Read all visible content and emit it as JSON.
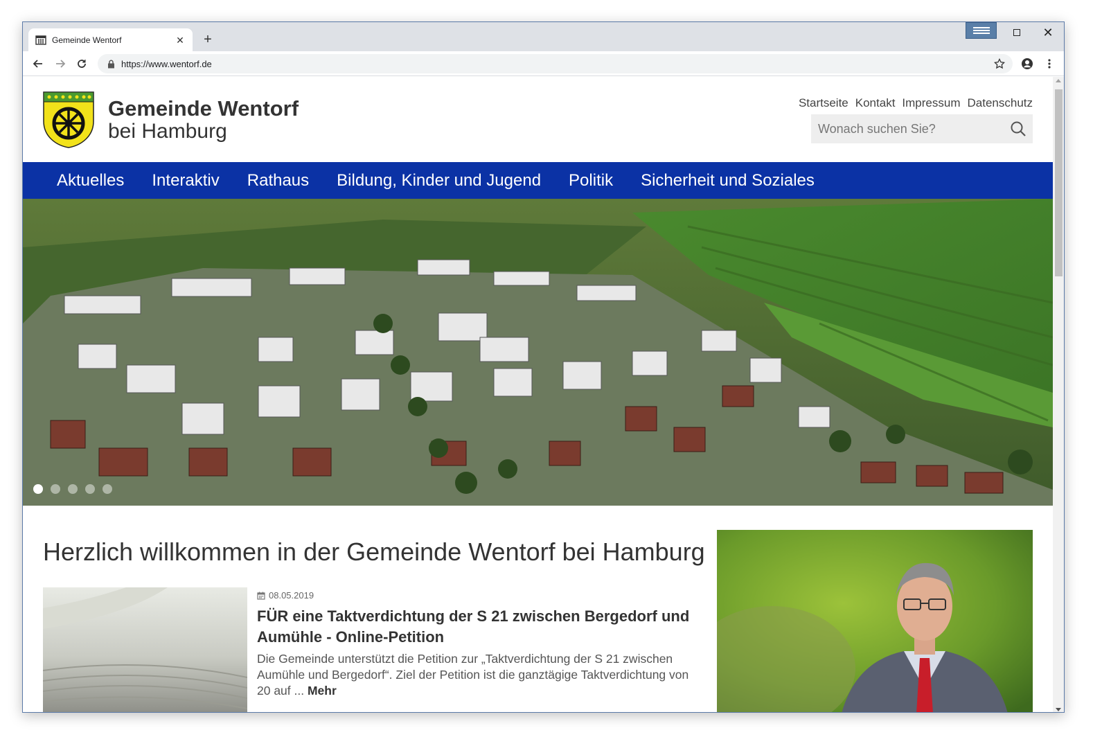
{
  "browser": {
    "tab_title": "Gemeinde Wentorf",
    "url": "https://www.wentorf.de",
    "close_symbol": "✕",
    "new_tab_symbol": "+"
  },
  "header": {
    "brand_line1": "Gemeinde Wentorf",
    "brand_line2": "bei Hamburg",
    "top_links": [
      "Startseite",
      "Kontakt",
      "Impressum",
      "Datenschutz"
    ],
    "search_placeholder": "Wonach suchen Sie?"
  },
  "nav": {
    "items": [
      "Aktuelles",
      "Interaktiv",
      "Rathaus",
      "Bildung, Kinder und Jugend",
      "Politik",
      "Sicherheit und Soziales"
    ]
  },
  "hero": {
    "slide_count": 5,
    "active_slide": 1
  },
  "main": {
    "welcome_title": "Herzlich willkommen in der Gemeinde Wentorf bei Hamburg",
    "news": {
      "date": "08.05.2019",
      "title": "FÜR eine Taktverdichtung der S 21 zwischen Bergedorf und Aumühle - Online-Petition",
      "text": "Die Gemeinde unterstützt die Petition zur „Taktverdichtung der S 21 zwischen Aumühle und Bergedorf“. Ziel der Petition ist die ganztägige Taktverdichtung von 20 auf ...",
      "more_label": "Mehr"
    }
  },
  "colors": {
    "nav_bg": "#0b32a5",
    "crest_yellow": "#f2e21a",
    "crest_green": "#4a9a2f"
  }
}
